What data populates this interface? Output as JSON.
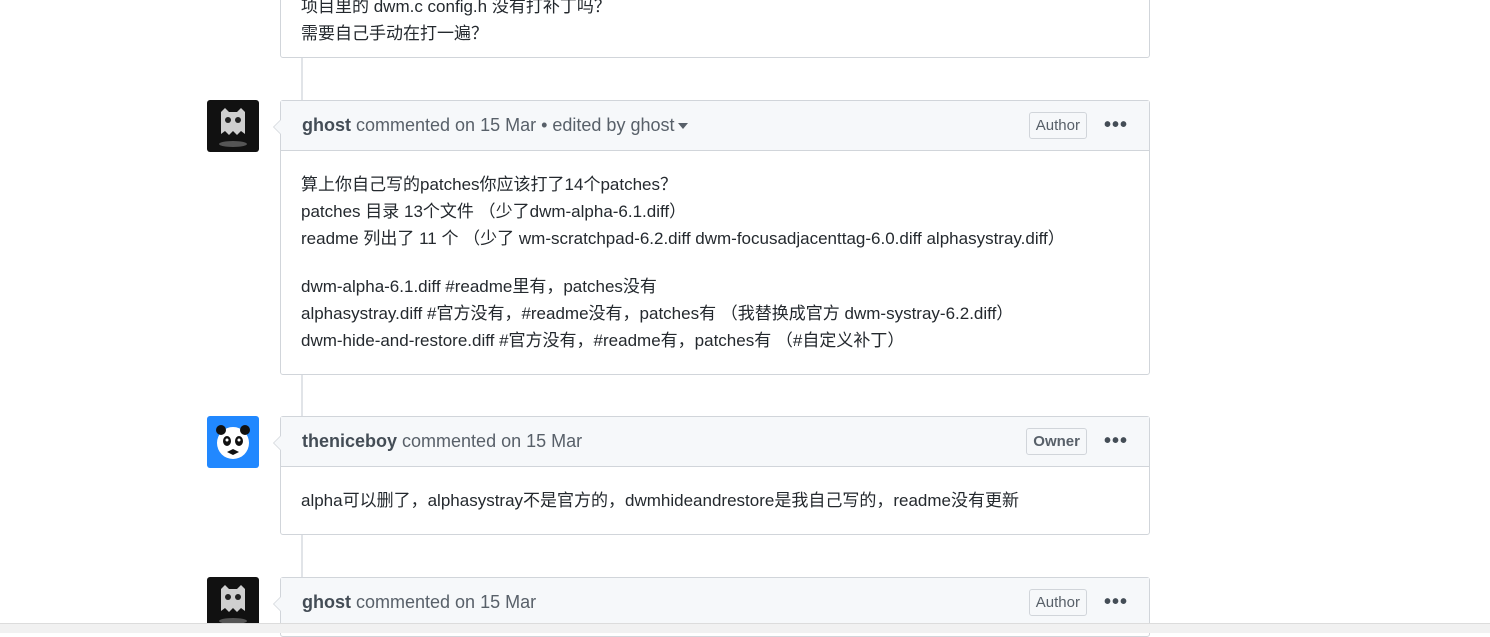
{
  "comments": [
    {
      "author": "",
      "meta": "",
      "body": [
        "项目里的 dwm.c config.h 没有打补丁吗？",
        "需要自己手动在打一遍？"
      ]
    },
    {
      "author": "ghost",
      "meta": "commented on 15 Mar • edited by ghost",
      "badge": "Author",
      "more": "•••",
      "body_paragraphs": [
        [
          "算上你自己写的patches你应该打了14个patches？",
          "patches 目录 13个文件 （少了dwm-alpha-6.1.diff）",
          "readme 列出了 11 个 （少了 wm-scratchpad-6.2.diff dwm-focusadjacenttag-6.0.diff alphasystray.diff）"
        ],
        [
          "dwm-alpha-6.1.diff #readme里有，patches没有",
          "alphasystray.diff #官方没有，#readme没有，patches有 （我替换成官方 dwm-systray-6.2.diff）",
          "dwm-hide-and-restore.diff #官方没有，#readme有，patches有 （#自定义补丁）"
        ]
      ]
    },
    {
      "author": "theniceboy",
      "meta": "commented on 15 Mar",
      "badge": "Owner",
      "more": "•••",
      "body": "alpha可以删了，alphasystray不是官方的，dwmhideandrestore是我自己写的，readme没有更新"
    },
    {
      "author": "ghost",
      "meta": "commented on 15 Mar",
      "badge": "Author",
      "more": "•••"
    }
  ],
  "icons": {
    "ghost_avatar": "ghost-avatar-icon",
    "panda_avatar": "panda-avatar-icon",
    "dropdown": "caret-down-icon",
    "more": "kebab-horizontal-icon"
  },
  "colors": {
    "border": "#d1d5da",
    "header_bg": "#f6f8fa",
    "text": "#24292e",
    "muted": "#586069",
    "timeline": "#e1e4e8",
    "panda_bg": "#2188ff"
  }
}
